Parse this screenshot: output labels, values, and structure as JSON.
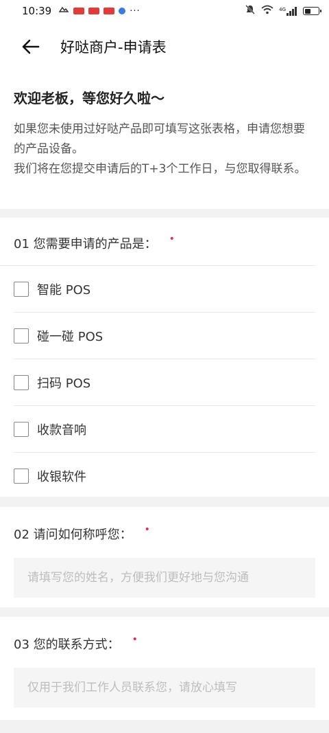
{
  "status_bar": {
    "time": "10:39",
    "dots": "···",
    "network": "4G"
  },
  "header": {
    "title": "好哒商户-申请表"
  },
  "intro": {
    "welcome": "欢迎老板，等您好久啦～",
    "line1": "如果您未使用过好哒产品即可填写这张表格，申请您想要的产品设备。",
    "line2": "我们将在您提交申请后的T+3个工作日，与您取得联系。"
  },
  "question1": {
    "title": "01 您需要申请的产品是：",
    "required_mark": "•",
    "options": [
      "智能 POS",
      "碰一碰 POS",
      "扫码 POS",
      "收款音响",
      "收银软件"
    ]
  },
  "question2": {
    "title": "02 请问如何称呼您：",
    "required_mark": "•",
    "placeholder": "请填写您的姓名，方便我们更好地与您沟通"
  },
  "question3": {
    "title": "03 您的联系方式：",
    "required_mark": "•",
    "placeholder": "仅用于我们工作人员联系您，请放心填写"
  },
  "colors": {
    "required": "#e8284c",
    "background": "#f2f2f2",
    "divider": "#e8e8e8",
    "input_bg": "#f5f5f5"
  }
}
